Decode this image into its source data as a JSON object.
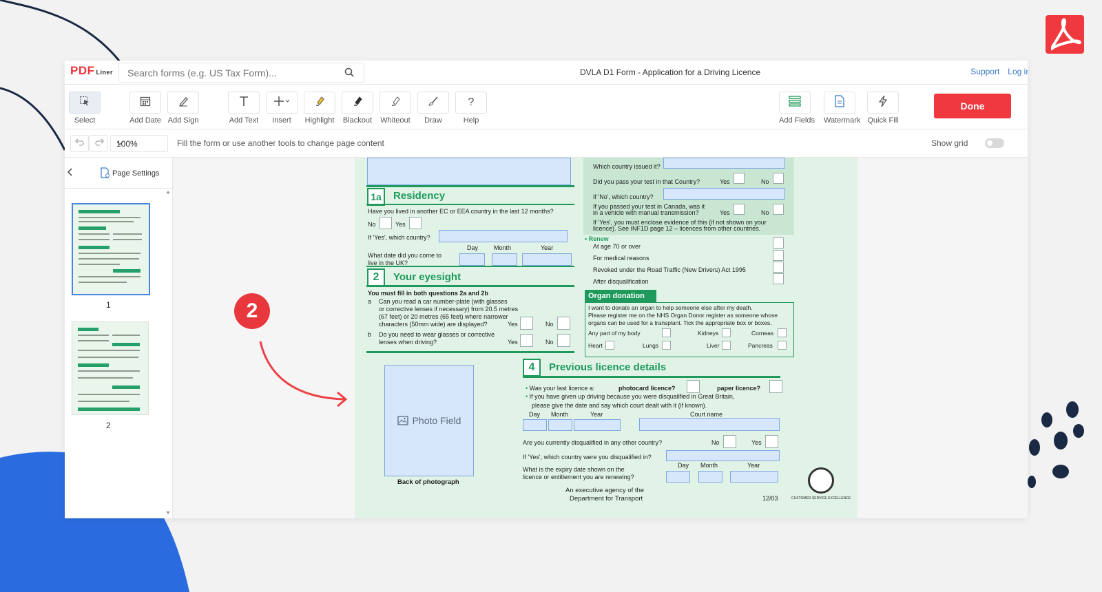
{
  "header": {
    "logo_main": "PDF",
    "logo_sub": "Liner",
    "search_placeholder": "Search forms (e.g. US Tax Form)...",
    "document_title": "DVLA D1 Form - Application for a Driving Licence",
    "support_link": "Support",
    "login_link": "Log in"
  },
  "toolbar": {
    "tools": [
      {
        "label": "Select",
        "icon": "select-cursor-icon"
      },
      {
        "label": "Add Date",
        "icon": "calendar-icon"
      },
      {
        "label": "Add Sign",
        "icon": "signature-pen-icon"
      },
      {
        "label": "Add Text",
        "icon": "text-icon"
      },
      {
        "label": "Insert",
        "icon": "plus-icon"
      },
      {
        "label": "Highlight",
        "icon": "highlighter-icon"
      },
      {
        "label": "Blackout",
        "icon": "blackout-icon"
      },
      {
        "label": "Whiteout",
        "icon": "whiteout-icon"
      },
      {
        "label": "Draw",
        "icon": "brush-icon"
      },
      {
        "label": "Help",
        "icon": "question-icon"
      }
    ],
    "right_tools": [
      {
        "label": "Add Fields",
        "icon": "add-fields-icon"
      },
      {
        "label": "Watermark",
        "icon": "watermark-icon"
      },
      {
        "label": "Quick Fill",
        "icon": "lightning-icon"
      }
    ],
    "done_label": "Done"
  },
  "subbar": {
    "zoom": "100%",
    "hint": "Fill the form or use another tools to change page content",
    "show_grid_label": "Show grid",
    "show_grid_on": false
  },
  "sidebar": {
    "page_settings": "Page Settings",
    "pages": [
      "1",
      "2"
    ]
  },
  "step_badge": "2",
  "form": {
    "which_country_issued": "Which country issued it?",
    "pass_test_q": "Did you pass your test in that Country?",
    "yes": "Yes",
    "no": "No",
    "if_no_country": "If 'No', which country?",
    "canada_q1": "If you passed your test in Canada, was it",
    "canada_q2": "in a vehicle with manual transmission?",
    "evidence1": "If 'Yes', you must enclose evidence of this (if not shown on your",
    "evidence2": "licence). See INF1D page 12 – licences from other countries.",
    "renew_heading": "• Renew",
    "renew_items": [
      "At age 70 or over",
      "For medical reasons",
      "Revoked under the Road Traffic (New Drivers) Act 1995",
      "After disqualification"
    ],
    "organ_heading": "Organ donation",
    "organ_text1": "I want to donate an organ to help someone else after my death.",
    "organ_text2": "Please register me on the NHS Organ Donor register as someone whose",
    "organ_text3": "organs can be used for a transplant. Tick the appropriate box or boxes.",
    "organ_any": "Any part of my body",
    "organ_kidneys": "Kidneys",
    "organ_corneas": "Corneas",
    "organ_heart": "Heart",
    "organ_lungs": "Lungs",
    "organ_liver": "Liver",
    "organ_pancreas": "Pancreas",
    "residency_num": "1a",
    "residency_title": "Residency",
    "residency_q": "Have you lived in another EC or EEA country in the last 12 months?",
    "residency_country": "If 'Yes', which country?",
    "day": "Day",
    "month": "Month",
    "year": "Year",
    "date_q1": "What date did you come to",
    "date_q2": "live in the UK?",
    "eyesight_num": "2",
    "eyesight_title": "Your eyesight",
    "eyesight_must": "You must fill in both questions 2a and 2b",
    "eye_a_letter": "a",
    "eye_a1": "Can you read a car number-plate (with glasses",
    "eye_a2": "or corrective lenses if necessary) from 20.5 metres",
    "eye_a3": "(67 feet) or 20 metres (65 feet) where narrower",
    "eye_a4": "characters (50mm wide) are displayed?",
    "eye_b_letter": "b",
    "eye_b1": "Do you need to wear glasses or corrective",
    "eye_b2": "lenses when driving?",
    "photo_field": "Photo Field",
    "back_of_photo": "Back of photograph",
    "prev_num": "4",
    "prev_title": "Previous licence details",
    "last_licence": "Was your last licence a:",
    "photocard": "photocard licence?",
    "paper": "paper licence?",
    "given_up1": "If you have given up driving because you were disqualified in Great Britain,",
    "given_up2": "please give the date and say which court dealt with it (if known).",
    "court_name": "Court name",
    "disq_other": "Are you currently disqualified in any other country?",
    "disq_which": "If 'Yes', which country were you disqualified in?",
    "expiry1": "What is the expiry date shown on the",
    "expiry2": "licence or entitlement you are renewing?",
    "agency1": "An executive agency of the",
    "agency2": "Department for Transport",
    "form_code": "12/03",
    "cse": "CUSTOMER SERVICE EXCELLENCE"
  },
  "colors": {
    "brand_red": "#e8363d",
    "form_green": "#1f9a5c",
    "field_blue": "#d6e6fb",
    "link_blue": "#3a79c9"
  }
}
